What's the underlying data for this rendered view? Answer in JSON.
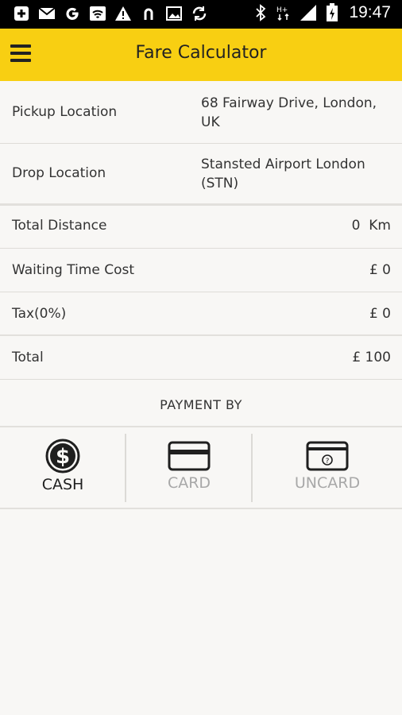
{
  "status_bar": {
    "time": "19:47",
    "icons": [
      "add-box-icon",
      "mail-icon",
      "google-icon",
      "wifi-icon",
      "warning-icon",
      "app-icon",
      "image-icon",
      "sync-icon",
      "bluetooth-icon",
      "ht-signal-icon",
      "signal-icon",
      "battery-icon"
    ]
  },
  "app_bar": {
    "title": "Fare Calculator",
    "menu_icon": "menu-icon"
  },
  "locations": {
    "pickup_label": "Pickup Location",
    "pickup_value": "68 Fairway Drive, London, UK",
    "drop_label": "Drop Location",
    "drop_value": "Stansted Airport London (STN)"
  },
  "fare": {
    "distance_label": "Total Distance",
    "distance_value": "0  Km",
    "waiting_label": "Waiting Time Cost",
    "waiting_value": "£ 0",
    "tax_label": "Tax(0%)",
    "tax_value": "£ 0",
    "total_label": "Total",
    "total_value": "£ 100"
  },
  "payment": {
    "title": "PAYMENT BY",
    "options": [
      {
        "label": "CASH",
        "icon": "dollar-circle-icon",
        "selected": true
      },
      {
        "label": "CARD",
        "icon": "credit-card-icon",
        "selected": false
      },
      {
        "label": "UNCARD",
        "icon": "unknown-card-icon",
        "selected": false
      }
    ],
    "colors": {
      "selected": "#1f1f1f",
      "unselected": "#a8a8a8"
    }
  },
  "colors": {
    "accent": "#f8cf12",
    "background": "#f8f7f5"
  }
}
